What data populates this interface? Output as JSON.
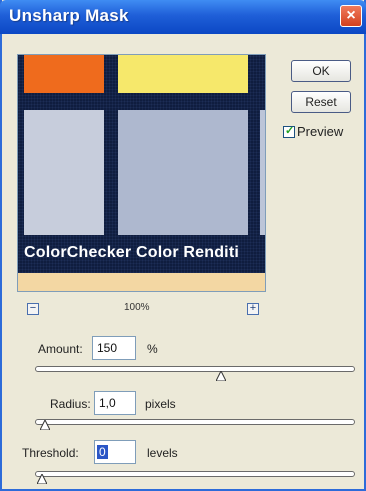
{
  "window": {
    "title": "Unsharp Mask"
  },
  "preview": {
    "caption": "ColorChecker Color Renditi",
    "zoom_value": "100%"
  },
  "buttons": {
    "ok": "OK",
    "reset": "Reset"
  },
  "preview_checkbox": {
    "label": "Preview",
    "checked": true
  },
  "amount": {
    "label": "Amount:",
    "value": "150",
    "unit": "%",
    "level": 0.64
  },
  "radius": {
    "label": "Radius:",
    "value": "1,0",
    "unit": "pixels",
    "level": 0.02
  },
  "threshold": {
    "label": "Threshold:",
    "value": "0",
    "unit": "levels",
    "level": 0.0
  },
  "colors": {
    "titlebar": "#1f5fd8",
    "dialog_bg": "#ece9d8",
    "close": "#d3411f"
  }
}
